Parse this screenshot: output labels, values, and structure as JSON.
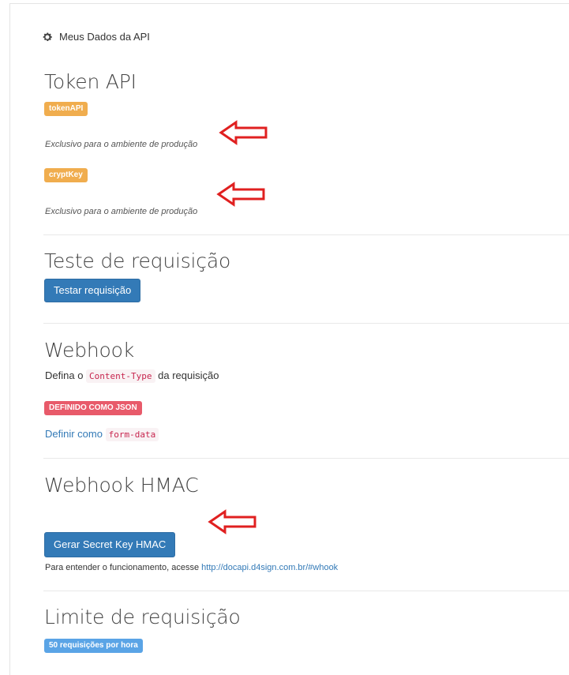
{
  "panel": {
    "title": "Meus Dados da API"
  },
  "token": {
    "heading": "Token API",
    "token_label": "tokenAPI",
    "token_note": "Exclusivo para o ambiente de produção",
    "crypt_label": "cryptKey",
    "crypt_note": "Exclusivo para o ambiente de produção"
  },
  "test": {
    "heading": "Teste de requisição",
    "button": "Testar requisição"
  },
  "webhook": {
    "heading": "Webhook",
    "text_before": "Defina o ",
    "code": "Content-Type",
    "text_after": " da requisição",
    "status": "DEFINIDO COMO JSON",
    "link": "Definir como",
    "link_code": "form-data"
  },
  "hmac": {
    "heading": "Webhook HMAC",
    "button": "Gerar Secret Key HMAC",
    "info_text": "Para entender o funcionamento, acesse ",
    "info_link": "http://docapi.d4sign.com.br/#whook"
  },
  "limit": {
    "heading": "Limite de requisição",
    "badge": "50 requisições por hora"
  },
  "colors": {
    "primary": "#337ab7",
    "warning": "#f0ad4e",
    "danger": "#e85a6a",
    "info": "#5aa4e6",
    "annotation_arrow": "#e02020"
  }
}
